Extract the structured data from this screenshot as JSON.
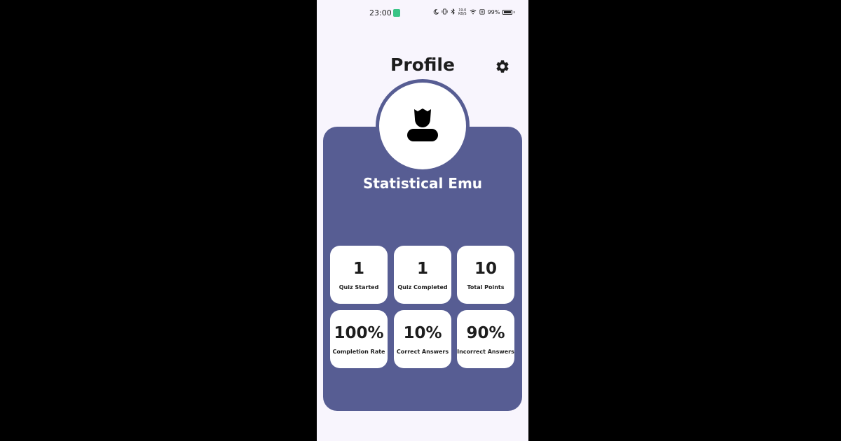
{
  "status_bar": {
    "time": "23:00",
    "net_speed_value": "19.0",
    "net_speed_unit": "KB/S",
    "battery": "99%"
  },
  "header": {
    "title": "Profile",
    "settings_icon": "gear-icon"
  },
  "profile": {
    "avatar_icon": "user-icon",
    "name": "Statistical Emu"
  },
  "stats": [
    {
      "value": "1",
      "label": "Quiz Started"
    },
    {
      "value": "1",
      "label": "Quiz Completed"
    },
    {
      "value": "10",
      "label": "Total Points"
    },
    {
      "value": "100%",
      "label": "Completion Rate"
    },
    {
      "value": "10%",
      "label": "Correct Answers"
    },
    {
      "value": "90%",
      "label": "Incorrect Answers"
    }
  ],
  "colors": {
    "card": "#575d93",
    "background": "#f8f5fd",
    "tile": "#ffffff",
    "text": "#1d1d1d"
  }
}
